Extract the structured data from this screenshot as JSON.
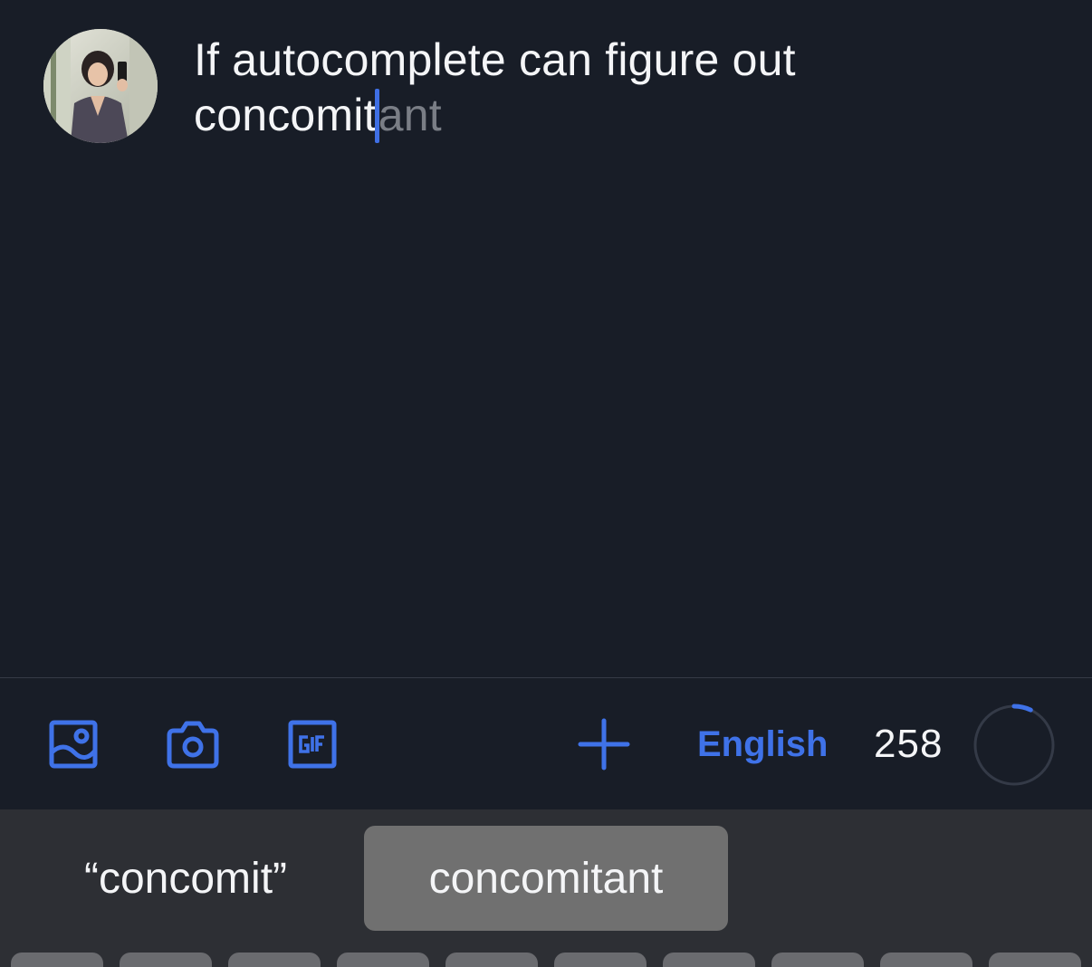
{
  "composer": {
    "typed_line_1": "If autocomplete can figure out",
    "typed_line_2": "concomit",
    "autocomplete_ghost": "ant"
  },
  "toolbar": {
    "icons": [
      "image-icon",
      "camera-icon",
      "gif-icon",
      "plus-icon"
    ],
    "language_label": "English",
    "characters_remaining": "258",
    "progress_fraction": 0.07,
    "accent_color": "#3f72e8"
  },
  "keyboard": {
    "suggestions": [
      {
        "label": "“concomit”",
        "selected": false
      },
      {
        "label": "concomitant",
        "selected": true
      }
    ]
  }
}
